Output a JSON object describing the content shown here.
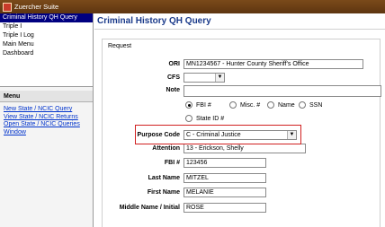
{
  "window": {
    "title": "Zuercher Suite"
  },
  "nav": {
    "items": [
      {
        "label": "Criminal History QH Query",
        "selected": true
      },
      {
        "label": "Triple I",
        "selected": false
      },
      {
        "label": "Triple I Log",
        "selected": false
      },
      {
        "label": "Main Menu",
        "selected": false
      },
      {
        "label": "Dashboard",
        "selected": false
      }
    ]
  },
  "menu": {
    "heading": "Menu",
    "links": [
      "New State / NCIC Query",
      "View State / NCIC Returns",
      "Open State / NCIC Queries Window"
    ]
  },
  "main": {
    "title": "Criminal History QH Query",
    "section_label": "Request",
    "ori": {
      "label": "ORI",
      "value": "MN1234567 - Hunter County Sheriff's Office"
    },
    "cfs": {
      "label": "CFS",
      "value": ""
    },
    "note": {
      "label": "Note",
      "value": ""
    },
    "search_by": {
      "options": [
        "FBI #",
        "Misc. #",
        "Name",
        "SSN",
        "State ID #"
      ],
      "selected": "FBI #"
    },
    "purpose_code": {
      "label": "Purpose Code",
      "value": "C - Criminal Justice"
    },
    "attention": {
      "label": "Attention",
      "value": "13 - Erickson, Shelly"
    },
    "fbi": {
      "label": "FBI #",
      "value": "123456"
    },
    "last_name": {
      "label": "Last Name",
      "value": "MITZEL"
    },
    "first_name": {
      "label": "First Name",
      "value": "MELANIE"
    },
    "middle_name": {
      "label": "Middle Name / Initial",
      "value": "ROSE"
    }
  },
  "colors": {
    "titlebar": "#6a3d14",
    "selection": "#000080",
    "link": "#0033cc",
    "highlight_box": "#d02020"
  }
}
